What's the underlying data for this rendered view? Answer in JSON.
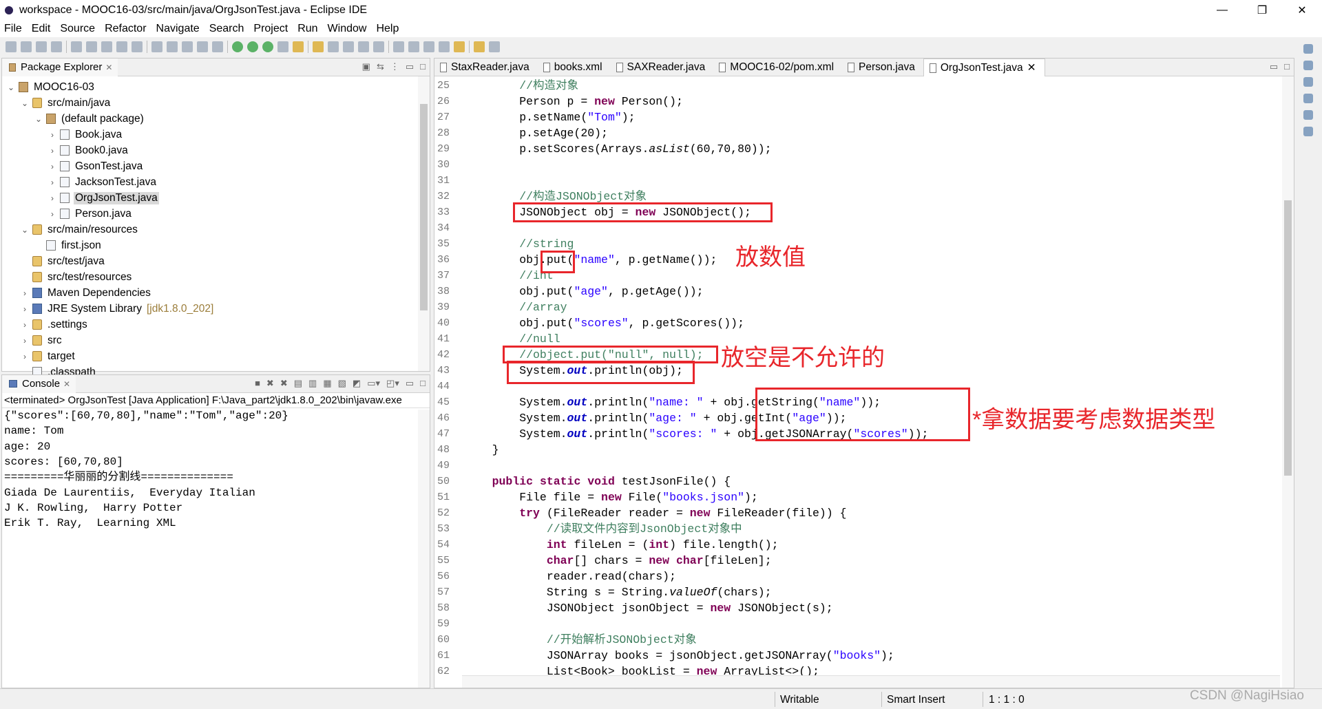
{
  "window": {
    "title": "workspace - MOOC16-03/src/main/java/OrgJsonTest.java - Eclipse IDE",
    "minimize": "—",
    "restore": "❐",
    "close": "✕"
  },
  "menu": [
    "File",
    "Edit",
    "Source",
    "Refactor",
    "Navigate",
    "Search",
    "Project",
    "Run",
    "Window",
    "Help"
  ],
  "package_explorer": {
    "title": "Package Explorer",
    "close": "✕",
    "items": [
      {
        "label": "MOOC16-03",
        "level": 0,
        "chevron": "⌄",
        "icon": "project-icon"
      },
      {
        "label": "src/main/java",
        "level": 1,
        "chevron": "⌄",
        "icon": "source-folder-icon"
      },
      {
        "label": "(default package)",
        "level": 2,
        "chevron": "⌄",
        "icon": "package-icon"
      },
      {
        "label": "Book.java",
        "level": 3,
        "chevron": "›",
        "icon": "java-file-icon"
      },
      {
        "label": "Book0.java",
        "level": 3,
        "chevron": "›",
        "icon": "java-file-icon"
      },
      {
        "label": "GsonTest.java",
        "level": 3,
        "chevron": "›",
        "icon": "java-file-icon"
      },
      {
        "label": "JacksonTest.java",
        "level": 3,
        "chevron": "›",
        "icon": "java-file-icon"
      },
      {
        "label": "OrgJsonTest.java",
        "level": 3,
        "chevron": "›",
        "icon": "java-file-icon",
        "selected": true
      },
      {
        "label": "Person.java",
        "level": 3,
        "chevron": "›",
        "icon": "java-file-icon"
      },
      {
        "label": "src/main/resources",
        "level": 1,
        "chevron": "⌄",
        "icon": "source-folder-icon"
      },
      {
        "label": "first.json",
        "level": 2,
        "chevron": "",
        "icon": "file-icon"
      },
      {
        "label": "src/test/java",
        "level": 1,
        "chevron": "",
        "icon": "source-folder-icon"
      },
      {
        "label": "src/test/resources",
        "level": 1,
        "chevron": "",
        "icon": "source-folder-icon"
      },
      {
        "label": "Maven Dependencies",
        "level": 1,
        "chevron": "›",
        "icon": "library-icon"
      },
      {
        "label": "JRE System Library",
        "suffix": "[jdk1.8.0_202]",
        "level": 1,
        "chevron": "›",
        "icon": "library-icon"
      },
      {
        "label": ".settings",
        "level": 1,
        "chevron": "›",
        "icon": "folder-icon"
      },
      {
        "label": "src",
        "level": 1,
        "chevron": "›",
        "icon": "folder-icon"
      },
      {
        "label": "target",
        "level": 1,
        "chevron": "›",
        "icon": "folder-icon"
      },
      {
        "label": ".classpath",
        "level": 1,
        "chevron": "",
        "icon": "xml-file-icon"
      }
    ]
  },
  "console": {
    "title": "Console",
    "close": "✕",
    "status": "<terminated> OrgJsonTest [Java Application] F:\\Java_part2\\jdk1.8.0_202\\bin\\javaw.exe",
    "lines": [
      "{\"scores\":[60,70,80],\"name\":\"Tom\",\"age\":20}",
      "name: Tom",
      "age: 20",
      "scores: [60,70,80]",
      "=========华丽丽的分割线==============",
      "Giada De Laurentiis,  Everyday Italian",
      "J K. Rowling,  Harry Potter",
      "Erik T. Ray,  Learning XML"
    ]
  },
  "editor": {
    "tabs": [
      {
        "label": "StaxReader.java"
      },
      {
        "label": "books.xml"
      },
      {
        "label": "SAXReader.java"
      },
      {
        "label": "MOOC16-02/pom.xml"
      },
      {
        "label": "Person.java"
      },
      {
        "label": "OrgJsonTest.java",
        "active": true,
        "close": "✕"
      }
    ],
    "lines": [
      {
        "n": "25",
        "t": [
          [
            "c",
            "        //构造对象"
          ]
        ]
      },
      {
        "n": "26",
        "t": [
          [
            "p",
            "        Person p = "
          ],
          [
            "k",
            "new"
          ],
          [
            "p",
            " Person();"
          ]
        ]
      },
      {
        "n": "27",
        "t": [
          [
            "p",
            "        p.setName("
          ],
          [
            "s",
            "\"Tom\""
          ],
          [
            "p",
            ");"
          ]
        ]
      },
      {
        "n": "28",
        "t": [
          [
            "p",
            "        p.setAge(20);"
          ]
        ]
      },
      {
        "n": "29",
        "t": [
          [
            "p",
            "        p.setScores(Arrays."
          ],
          [
            "i",
            "asList"
          ],
          [
            "p",
            "(60,70,80));"
          ]
        ]
      },
      {
        "n": "30",
        "t": []
      },
      {
        "n": "31",
        "t": []
      },
      {
        "n": "32",
        "t": [
          [
            "c",
            "        //构造JSONObject对象"
          ]
        ]
      },
      {
        "n": "33",
        "t": [
          [
            "p",
            "        JSONObject obj = "
          ],
          [
            "k",
            "new"
          ],
          [
            "p",
            " JSONObject();"
          ]
        ]
      },
      {
        "n": "34",
        "t": []
      },
      {
        "n": "35",
        "t": [
          [
            "c",
            "        //string"
          ]
        ]
      },
      {
        "n": "36",
        "t": [
          [
            "p",
            "        obj.put("
          ],
          [
            "s",
            "\"name\""
          ],
          [
            "p",
            ", p.getName());"
          ]
        ]
      },
      {
        "n": "37",
        "t": [
          [
            "c",
            "        //int"
          ]
        ]
      },
      {
        "n": "38",
        "t": [
          [
            "p",
            "        obj.put("
          ],
          [
            "s",
            "\"age\""
          ],
          [
            "p",
            ", p.getAge());"
          ]
        ]
      },
      {
        "n": "39",
        "t": [
          [
            "c",
            "        //array"
          ]
        ]
      },
      {
        "n": "40",
        "t": [
          [
            "p",
            "        obj.put("
          ],
          [
            "s",
            "\"scores\""
          ],
          [
            "p",
            ", p.getScores());"
          ]
        ]
      },
      {
        "n": "41",
        "t": [
          [
            "c",
            "        //null"
          ]
        ]
      },
      {
        "n": "42",
        "t": [
          [
            "c",
            "        //object.put(\"null\", null);"
          ]
        ]
      },
      {
        "n": "43",
        "t": [
          [
            "p",
            "        System."
          ],
          [
            "f",
            "out"
          ],
          [
            "p",
            ".println(obj);"
          ]
        ]
      },
      {
        "n": "44",
        "t": []
      },
      {
        "n": "45",
        "t": [
          [
            "p",
            "        System."
          ],
          [
            "f",
            "out"
          ],
          [
            "p",
            ".println("
          ],
          [
            "s",
            "\"name: \""
          ],
          [
            "p",
            " + obj.getString("
          ],
          [
            "s",
            "\"name\""
          ],
          [
            "p",
            "));"
          ]
        ]
      },
      {
        "n": "46",
        "t": [
          [
            "p",
            "        System."
          ],
          [
            "f",
            "out"
          ],
          [
            "p",
            ".println("
          ],
          [
            "s",
            "\"age: \""
          ],
          [
            "p",
            " + obj.getInt("
          ],
          [
            "s",
            "\"age\""
          ],
          [
            "p",
            "));"
          ]
        ]
      },
      {
        "n": "47",
        "t": [
          [
            "p",
            "        System."
          ],
          [
            "f",
            "out"
          ],
          [
            "p",
            ".println("
          ],
          [
            "s",
            "\"scores: \""
          ],
          [
            "p",
            " + obj.getJSONArray("
          ],
          [
            "s",
            "\"scores\""
          ],
          [
            "p",
            "));"
          ]
        ]
      },
      {
        "n": "48",
        "t": [
          [
            "p",
            "    }"
          ]
        ]
      },
      {
        "n": "49",
        "t": []
      },
      {
        "n": "50",
        "t": [
          [
            "p",
            "    "
          ],
          [
            "k",
            "public"
          ],
          [
            "p",
            " "
          ],
          [
            "k",
            "static"
          ],
          [
            "p",
            " "
          ],
          [
            "k",
            "void"
          ],
          [
            "p",
            " testJsonFile() {"
          ]
        ]
      },
      {
        "n": "51",
        "t": [
          [
            "p",
            "        File file = "
          ],
          [
            "k",
            "new"
          ],
          [
            "p",
            " File("
          ],
          [
            "s",
            "\"books.json\""
          ],
          [
            "p",
            ");"
          ]
        ]
      },
      {
        "n": "52",
        "t": [
          [
            "p",
            "        "
          ],
          [
            "k",
            "try"
          ],
          [
            "p",
            " (FileReader reader = "
          ],
          [
            "k",
            "new"
          ],
          [
            "p",
            " FileReader(file)) {"
          ]
        ]
      },
      {
        "n": "53",
        "t": [
          [
            "c",
            "            //读取文件内容到JsonObject对象中"
          ]
        ]
      },
      {
        "n": "54",
        "t": [
          [
            "p",
            "            "
          ],
          [
            "k",
            "int"
          ],
          [
            "p",
            " fileLen = ("
          ],
          [
            "k",
            "int"
          ],
          [
            "p",
            ") file.length();"
          ]
        ]
      },
      {
        "n": "55",
        "t": [
          [
            "p",
            "            "
          ],
          [
            "k",
            "char"
          ],
          [
            "p",
            "[] chars = "
          ],
          [
            "k",
            "new"
          ],
          [
            "p",
            " "
          ],
          [
            "k",
            "char"
          ],
          [
            "p",
            "[fileLen];"
          ]
        ]
      },
      {
        "n": "56",
        "t": [
          [
            "p",
            "            reader.read(chars);"
          ]
        ]
      },
      {
        "n": "57",
        "t": [
          [
            "p",
            "            String s = String."
          ],
          [
            "i",
            "valueOf"
          ],
          [
            "p",
            "(chars);"
          ]
        ]
      },
      {
        "n": "58",
        "t": [
          [
            "p",
            "            JSONObject jsonObject = "
          ],
          [
            "k",
            "new"
          ],
          [
            "p",
            " JSONObject(s);"
          ]
        ]
      },
      {
        "n": "59",
        "t": []
      },
      {
        "n": "60",
        "t": [
          [
            "c",
            "            //开始解析JSONObject对象"
          ]
        ]
      },
      {
        "n": "61",
        "t": [
          [
            "p",
            "            JSONArray books = jsonObject.getJSONArray("
          ],
          [
            "s",
            "\"books\""
          ],
          [
            "p",
            ");"
          ]
        ]
      },
      {
        "n": "62",
        "t": [
          [
            "p",
            "            List<Book> bookList = "
          ],
          [
            "k",
            "new"
          ],
          [
            "p",
            " ArrayList<>();"
          ]
        ]
      }
    ]
  },
  "annotations": {
    "put_value": "放数值",
    "null_not_allowed": "放空是不允许的",
    "get_types": "*拿数据要考虑数据类型",
    "color": "#e8262b"
  },
  "status": {
    "writable": "Writable",
    "insert_mode": "Smart Insert",
    "position": "1 : 1 : 0"
  },
  "watermark": "CSDN @NagiHsiao"
}
